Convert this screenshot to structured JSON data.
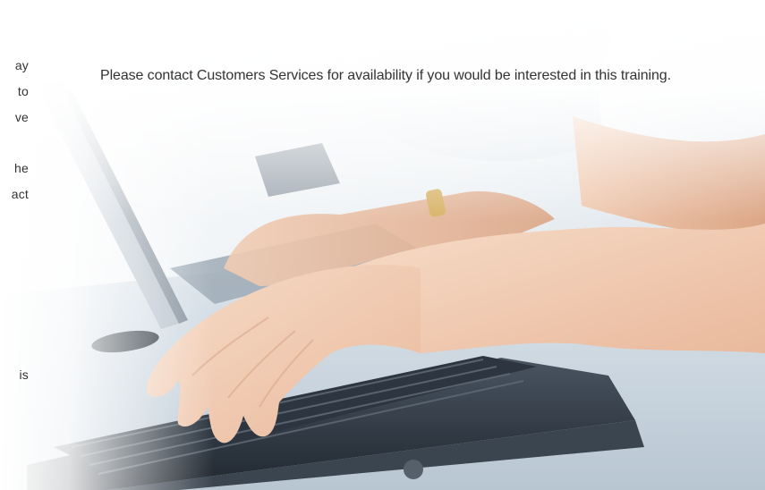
{
  "left_column": {
    "fragments": [
      "ay",
      "to",
      "ve",
      "he",
      "act",
      "is"
    ]
  },
  "notice": {
    "text": "Please contact Customers Services for availability if you would be interested in this training."
  },
  "photo": {
    "subject_icon": "typing-hands-laptop-photo"
  }
}
